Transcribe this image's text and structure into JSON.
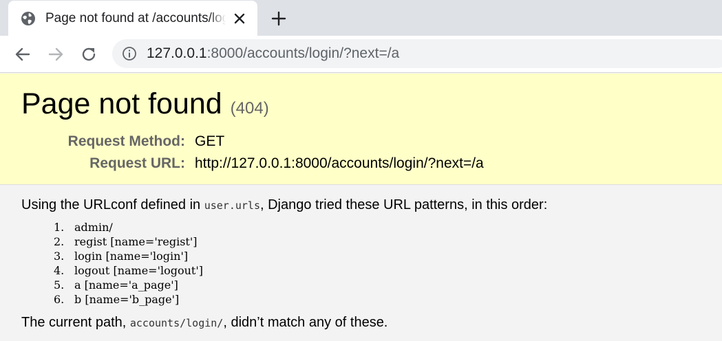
{
  "browser": {
    "tab": {
      "title": "Page not found at /accounts/login/",
      "close_icon": "close-icon",
      "favicon": "globe-icon"
    },
    "new_tab_icon": "plus-icon",
    "nav": {
      "back_icon": "arrow-left-icon",
      "forward_icon": "arrow-right-icon",
      "reload_icon": "reload-icon"
    },
    "omnibox": {
      "info_icon": "info-icon",
      "host": "127.0.0.1",
      "rest": ":8000/accounts/login/?next=/a"
    }
  },
  "summary": {
    "title": "Page not found",
    "code": "(404)",
    "request_method_label": "Request Method:",
    "request_method_value": "GET",
    "request_url_label": "Request URL:",
    "request_url_value": "http://127.0.0.1:8000/accounts/login/?next=/a"
  },
  "info": {
    "intro_before": "Using the URLconf defined in ",
    "intro_code": "user.urls",
    "intro_after": ", Django tried these URL patterns, in this order:",
    "patterns": [
      {
        "num": "1.",
        "text": "admin/"
      },
      {
        "num": "2.",
        "text": "regist [name='regist']"
      },
      {
        "num": "3.",
        "text": "login [name='login']"
      },
      {
        "num": "4.",
        "text": "logout [name='logout']"
      },
      {
        "num": "5.",
        "text": "a [name='a_page']"
      },
      {
        "num": "6.",
        "text": "b [name='b_page']"
      }
    ],
    "current_before": "The current path, ",
    "current_code": "accounts/login/",
    "current_after": ", didn’t match any of these."
  },
  "colors": {
    "summary_bg": "#ffffc8",
    "tabstrip_bg": "#dee1e6",
    "label_grey": "#666666"
  }
}
